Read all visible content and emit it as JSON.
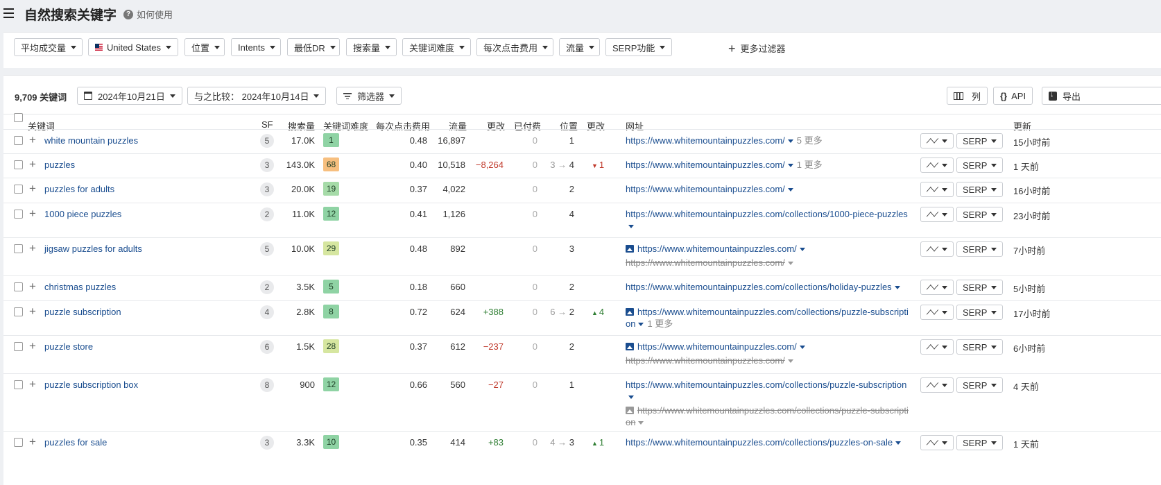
{
  "header": {
    "title": "自然搜索关键字",
    "help_label": "如何使用"
  },
  "filters": {
    "items": [
      "平均成交量",
      "United States",
      "位置",
      "Intents",
      "最低DR",
      "搜索量",
      "关键词难度",
      "每次点击费用",
      "流量",
      "SERP功能"
    ],
    "more_label": "更多过滤器"
  },
  "toolbar": {
    "count_label": "9,709 关键词",
    "date": "2024年10月21日",
    "compare": "与之比较： 2024年10月14日",
    "filter_label": "筛选器",
    "columns_label": "列",
    "api_label": "API",
    "export_label": "导出"
  },
  "table": {
    "headers": {
      "keyword": "关键词",
      "sf": "SF",
      "volume": "搜索量",
      "kd": "关键词难度",
      "cpc": "每次点击费用",
      "traffic": "流量",
      "change": "更改",
      "paid": "已付费",
      "position": "位置",
      "pos_change": "更改",
      "url": "网址",
      "updated": "更新"
    },
    "serp_label": "SERP",
    "rows": [
      {
        "keyword": "white mountain puzzles",
        "sf": "5",
        "volume": "17.0K",
        "kd": "1",
        "kd_color": "#8fd3a4",
        "cpc": "0.48",
        "traffic": "16,897",
        "change": "",
        "change_type": "",
        "paid": "0",
        "pos_from": "",
        "pos_to": "1",
        "pos_change": "",
        "pos_change_dir": "",
        "url": "https://www.whitemountainpuzzles.com/",
        "url_more": "5 更多",
        "url_image": false,
        "old_url": "",
        "old_url_image": false,
        "updated": "15小时前"
      },
      {
        "keyword": "puzzles",
        "sf": "3",
        "volume": "143.0K",
        "kd": "68",
        "kd_color": "#f7bf7f",
        "cpc": "0.40",
        "traffic": "10,518",
        "change": "−8,264",
        "change_type": "neg",
        "paid": "0",
        "pos_from": "3",
        "pos_to": "4",
        "pos_change": "1",
        "pos_change_dir": "down",
        "url": "https://www.whitemountainpuzzles.com/",
        "url_more": "1 更多",
        "url_image": false,
        "old_url": "",
        "old_url_image": false,
        "updated": "1 天前"
      },
      {
        "keyword": "puzzles for adults",
        "sf": "3",
        "volume": "20.0K",
        "kd": "19",
        "kd_color": "#a6dba8",
        "cpc": "0.37",
        "traffic": "4,022",
        "change": "",
        "change_type": "",
        "paid": "0",
        "pos_from": "",
        "pos_to": "2",
        "pos_change": "",
        "pos_change_dir": "",
        "url": "https://www.whitemountainpuzzles.com/",
        "url_more": "",
        "url_image": false,
        "old_url": "",
        "old_url_image": false,
        "updated": "16小时前"
      },
      {
        "keyword": "1000 piece puzzles",
        "sf": "2",
        "volume": "11.0K",
        "kd": "12",
        "kd_color": "#8fd3a4",
        "cpc": "0.41",
        "traffic": "1,126",
        "change": "",
        "change_type": "",
        "paid": "0",
        "pos_from": "",
        "pos_to": "4",
        "pos_change": "",
        "pos_change_dir": "",
        "url": "https://www.whitemountainpuzzles.com/collections/1000-piece-puzzles",
        "url_more": "",
        "url_image": false,
        "old_url": "",
        "old_url_image": false,
        "updated": "23小时前"
      },
      {
        "keyword": "jigsaw puzzles for adults",
        "sf": "5",
        "volume": "10.0K",
        "kd": "29",
        "kd_color": "#d6e6a0",
        "cpc": "0.48",
        "traffic": "892",
        "change": "",
        "change_type": "",
        "paid": "0",
        "pos_from": "",
        "pos_to": "3",
        "pos_change": "",
        "pos_change_dir": "",
        "url": "https://www.whitemountainpuzzles.com/",
        "url_more": "",
        "url_image": true,
        "old_url": "https://www.whitemountainpuzzles.com/",
        "old_url_image": false,
        "updated": "7小时前"
      },
      {
        "keyword": "christmas puzzles",
        "sf": "2",
        "volume": "3.5K",
        "kd": "5",
        "kd_color": "#8fd3a4",
        "cpc": "0.18",
        "traffic": "660",
        "change": "",
        "change_type": "",
        "paid": "0",
        "pos_from": "",
        "pos_to": "2",
        "pos_change": "",
        "pos_change_dir": "",
        "url": "https://www.whitemountainpuzzles.com/collections/holiday-puzzles",
        "url_more": "",
        "url_image": false,
        "old_url": "",
        "old_url_image": false,
        "updated": "5小时前"
      },
      {
        "keyword": "puzzle subscription",
        "sf": "4",
        "volume": "2.8K",
        "kd": "8",
        "kd_color": "#8fd3a4",
        "cpc": "0.72",
        "traffic": "624",
        "change": "+388",
        "change_type": "pos",
        "paid": "0",
        "pos_from": "6",
        "pos_to": "2",
        "pos_change": "4",
        "pos_change_dir": "up",
        "url": "https://www.whitemountainpuzzles.com/collections/puzzle-subscription",
        "url_more": "1 更多",
        "url_image": true,
        "old_url": "",
        "old_url_image": false,
        "updated": "17小时前"
      },
      {
        "keyword": "puzzle store",
        "sf": "6",
        "volume": "1.5K",
        "kd": "28",
        "kd_color": "#d6e6a0",
        "cpc": "0.37",
        "traffic": "612",
        "change": "−237",
        "change_type": "neg",
        "paid": "0",
        "pos_from": "",
        "pos_to": "2",
        "pos_change": "",
        "pos_change_dir": "",
        "url": "https://www.whitemountainpuzzles.com/",
        "url_more": "",
        "url_image": true,
        "old_url": "https://www.whitemountainpuzzles.com/",
        "old_url_image": false,
        "updated": "6小时前"
      },
      {
        "keyword": "puzzle subscription box",
        "sf": "8",
        "volume": "900",
        "kd": "12",
        "kd_color": "#8fd3a4",
        "cpc": "0.66",
        "traffic": "560",
        "change": "−27",
        "change_type": "neg",
        "paid": "0",
        "pos_from": "",
        "pos_to": "1",
        "pos_change": "",
        "pos_change_dir": "",
        "url": "https://www.whitemountainpuzzles.com/collections/puzzle-subscription",
        "url_more": "",
        "url_image": false,
        "old_url": "https://www.whitemountainpuzzles.com/collections/puzzle-subscription",
        "old_url_image": true,
        "updated": "4 天前"
      },
      {
        "keyword": "puzzles for sale",
        "sf": "3",
        "volume": "3.3K",
        "kd": "10",
        "kd_color": "#8fd3a4",
        "cpc": "0.35",
        "traffic": "414",
        "change": "+83",
        "change_type": "pos",
        "paid": "0",
        "pos_from": "4",
        "pos_to": "3",
        "pos_change": "1",
        "pos_change_dir": "up",
        "url": "https://www.whitemountainpuzzles.com/collections/puzzles-on-sale",
        "url_more": "",
        "url_image": false,
        "old_url": "",
        "old_url_image": false,
        "updated": "1 天前"
      }
    ]
  }
}
